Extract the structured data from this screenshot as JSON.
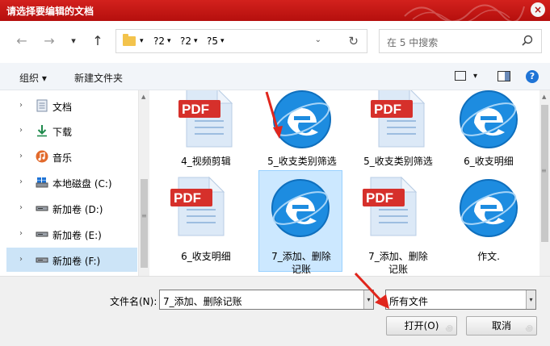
{
  "window": {
    "title": "请选择要编辑的文档",
    "close_glyph": "×"
  },
  "nav": {
    "back_glyph": "←",
    "forward_glyph": "→",
    "recent_glyph": "▾",
    "up_glyph": "↑",
    "breadcrumbs": [
      "?2",
      "?2",
      "?5"
    ],
    "crumb_sep": "▾",
    "address_dropdown_glyph": "⌄",
    "refresh_glyph": "↻",
    "search_placeholder": "在 5 中搜索"
  },
  "toolbar": {
    "organize_label": "组织 ▾",
    "new_folder_label": "新建文件夹",
    "view_dropdown_glyph": "▾",
    "help_glyph": "?"
  },
  "sidebar": {
    "items": [
      {
        "label": "文档",
        "icon": "document-icon"
      },
      {
        "label": "下载",
        "icon": "download-icon"
      },
      {
        "label": "音乐",
        "icon": "music-icon"
      },
      {
        "label": "本地磁盘 (C:)",
        "icon": "drive-icon"
      },
      {
        "label": "新加卷 (D:)",
        "icon": "drive-icon"
      },
      {
        "label": "新加卷 (E:)",
        "icon": "drive-icon"
      },
      {
        "label": "新加卷 (F:)",
        "icon": "drive-icon",
        "selected": true
      }
    ],
    "chevron_glyph": "›"
  },
  "files": [
    {
      "name": "4_视频剪辑",
      "type": "pdf"
    },
    {
      "name": "5_收支类别筛选",
      "type": "ie"
    },
    {
      "name": "5_收支类别筛选",
      "type": "pdf"
    },
    {
      "name": "6_收支明细",
      "type": "ie"
    },
    {
      "name": "6_收支明细",
      "type": "pdf"
    },
    {
      "name": "7_添加、删除记账",
      "type": "ie",
      "selected": true
    },
    {
      "name": "7_添加、删除记账",
      "type": "pdf"
    },
    {
      "name": "作文.",
      "type": "ie"
    }
  ],
  "pdf_badge": "PDF",
  "scroll": {
    "up_glyph": "▲",
    "grip_glyph": "≡"
  },
  "bottom": {
    "filename_label": "文件名(N):",
    "filename_value": "7_添加、删除记账",
    "filetype_value": "所有文件",
    "dropdown_glyph": "▾",
    "open_label": "打开(O)",
    "cancel_label": "取消",
    "swirl_glyph": "꩜"
  },
  "colors": {
    "title_bar": "#c8181a",
    "selection": "#cce8ff",
    "ie_blue": "#1d8ce0",
    "pdf_red": "#d6302b",
    "annotation_arrow": "#e0261d"
  }
}
